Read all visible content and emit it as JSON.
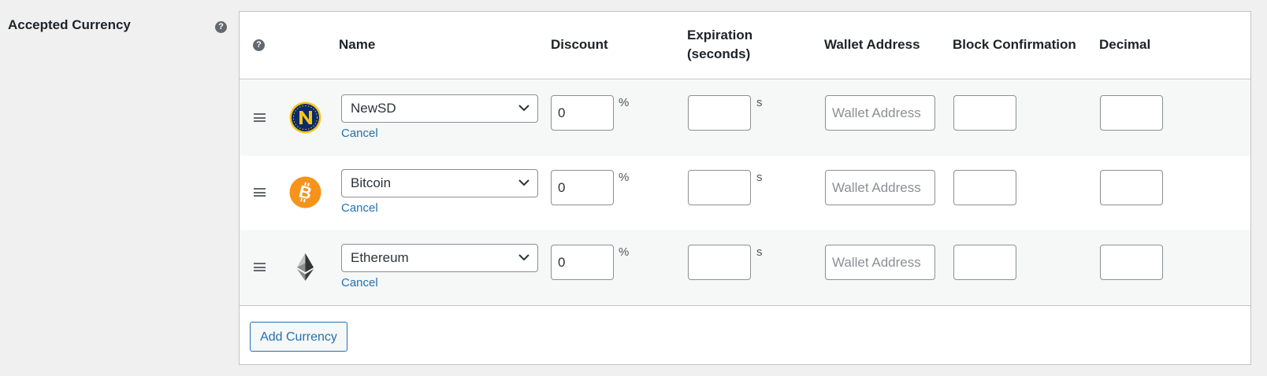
{
  "field": {
    "label": "Accepted Currency"
  },
  "icons": {
    "help": "question-circle-icon",
    "drag": "drag-handle-icon",
    "dropdown": "chevron-down-icon"
  },
  "colors": {
    "link": "#2271b1",
    "newsd_coin": "#0a2a6b",
    "newsd_accent": "#f5c518",
    "bitcoin": "#f7931a",
    "ethereum": "#343434"
  },
  "table": {
    "help_symbol": "?",
    "headers": {
      "name": "Name",
      "discount": "Discount",
      "expiration_line1": "Expiration",
      "expiration_line2": "(seconds)",
      "wallet": "Wallet Address",
      "block": "Block Confirmation",
      "decimal": "Decimal"
    },
    "rows": [
      {
        "coin": "NewSD",
        "logo": "newsd-logo",
        "cancel": "Cancel",
        "discount": "0",
        "discount_unit": "%",
        "expiration": "",
        "expiration_unit": "s",
        "wallet_placeholder": "Wallet Address",
        "block": "",
        "decimal": ""
      },
      {
        "coin": "Bitcoin",
        "logo": "bitcoin-logo",
        "cancel": "Cancel",
        "discount": "0",
        "discount_unit": "%",
        "expiration": "",
        "expiration_unit": "s",
        "wallet_placeholder": "Wallet Address",
        "block": "",
        "decimal": ""
      },
      {
        "coin": "Ethereum",
        "logo": "ethereum-logo",
        "cancel": "Cancel",
        "discount": "0",
        "discount_unit": "%",
        "expiration": "",
        "expiration_unit": "s",
        "wallet_placeholder": "Wallet Address",
        "block": "",
        "decimal": ""
      }
    ],
    "add_button": "Add Currency"
  }
}
